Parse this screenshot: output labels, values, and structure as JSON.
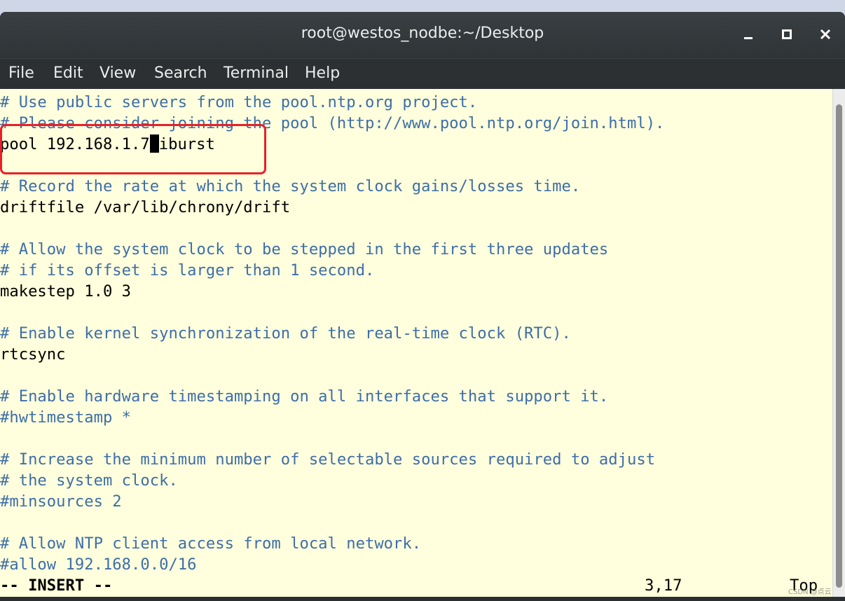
{
  "window": {
    "title": "root@westos_nodbe:~/Desktop"
  },
  "menu": {
    "items": [
      "File",
      "Edit",
      "View",
      "Search",
      "Terminal",
      "Help"
    ]
  },
  "editor": {
    "lines": [
      {
        "text": "# Use public servers from the pool.ntp.org project.",
        "kind": "comment"
      },
      {
        "text": "# Please consider joining the pool (http://www.pool.ntp.org/join.html).",
        "kind": "comment"
      },
      {
        "before_cursor": "pool 192.168.1.7",
        "after_cursor": "iburst",
        "kind": "code"
      },
      {
        "text": "",
        "kind": "blank"
      },
      {
        "text": "# Record the rate at which the system clock gains/losses time.",
        "kind": "comment"
      },
      {
        "text": "driftfile /var/lib/chrony/drift",
        "kind": "code"
      },
      {
        "text": "",
        "kind": "blank"
      },
      {
        "text": "# Allow the system clock to be stepped in the first three updates",
        "kind": "comment"
      },
      {
        "text": "# if its offset is larger than 1 second.",
        "kind": "comment"
      },
      {
        "text": "makestep 1.0 3",
        "kind": "code"
      },
      {
        "text": "",
        "kind": "blank"
      },
      {
        "text": "# Enable kernel synchronization of the real-time clock (RTC).",
        "kind": "comment"
      },
      {
        "text": "rtcsync",
        "kind": "code"
      },
      {
        "text": "",
        "kind": "blank"
      },
      {
        "text": "# Enable hardware timestamping on all interfaces that support it.",
        "kind": "comment"
      },
      {
        "text": "#hwtimestamp *",
        "kind": "comment"
      },
      {
        "text": "",
        "kind": "blank"
      },
      {
        "text": "# Increase the minimum number of selectable sources required to adjust",
        "kind": "comment"
      },
      {
        "text": "# the system clock.",
        "kind": "comment"
      },
      {
        "text": "#minsources 2",
        "kind": "comment"
      },
      {
        "text": "",
        "kind": "blank"
      },
      {
        "text": "# Allow NTP client access from local network.",
        "kind": "comment"
      },
      {
        "text": "#allow 192.168.0.0/16",
        "kind": "comment"
      }
    ],
    "status": {
      "mode": "-- INSERT --",
      "position": "3,17",
      "scroll": "Top"
    }
  },
  "colors": {
    "comment": "#3d6ea8",
    "background": "#ffffdd",
    "highlight": "#e8202a"
  },
  "watermark": "CSDN @点云"
}
